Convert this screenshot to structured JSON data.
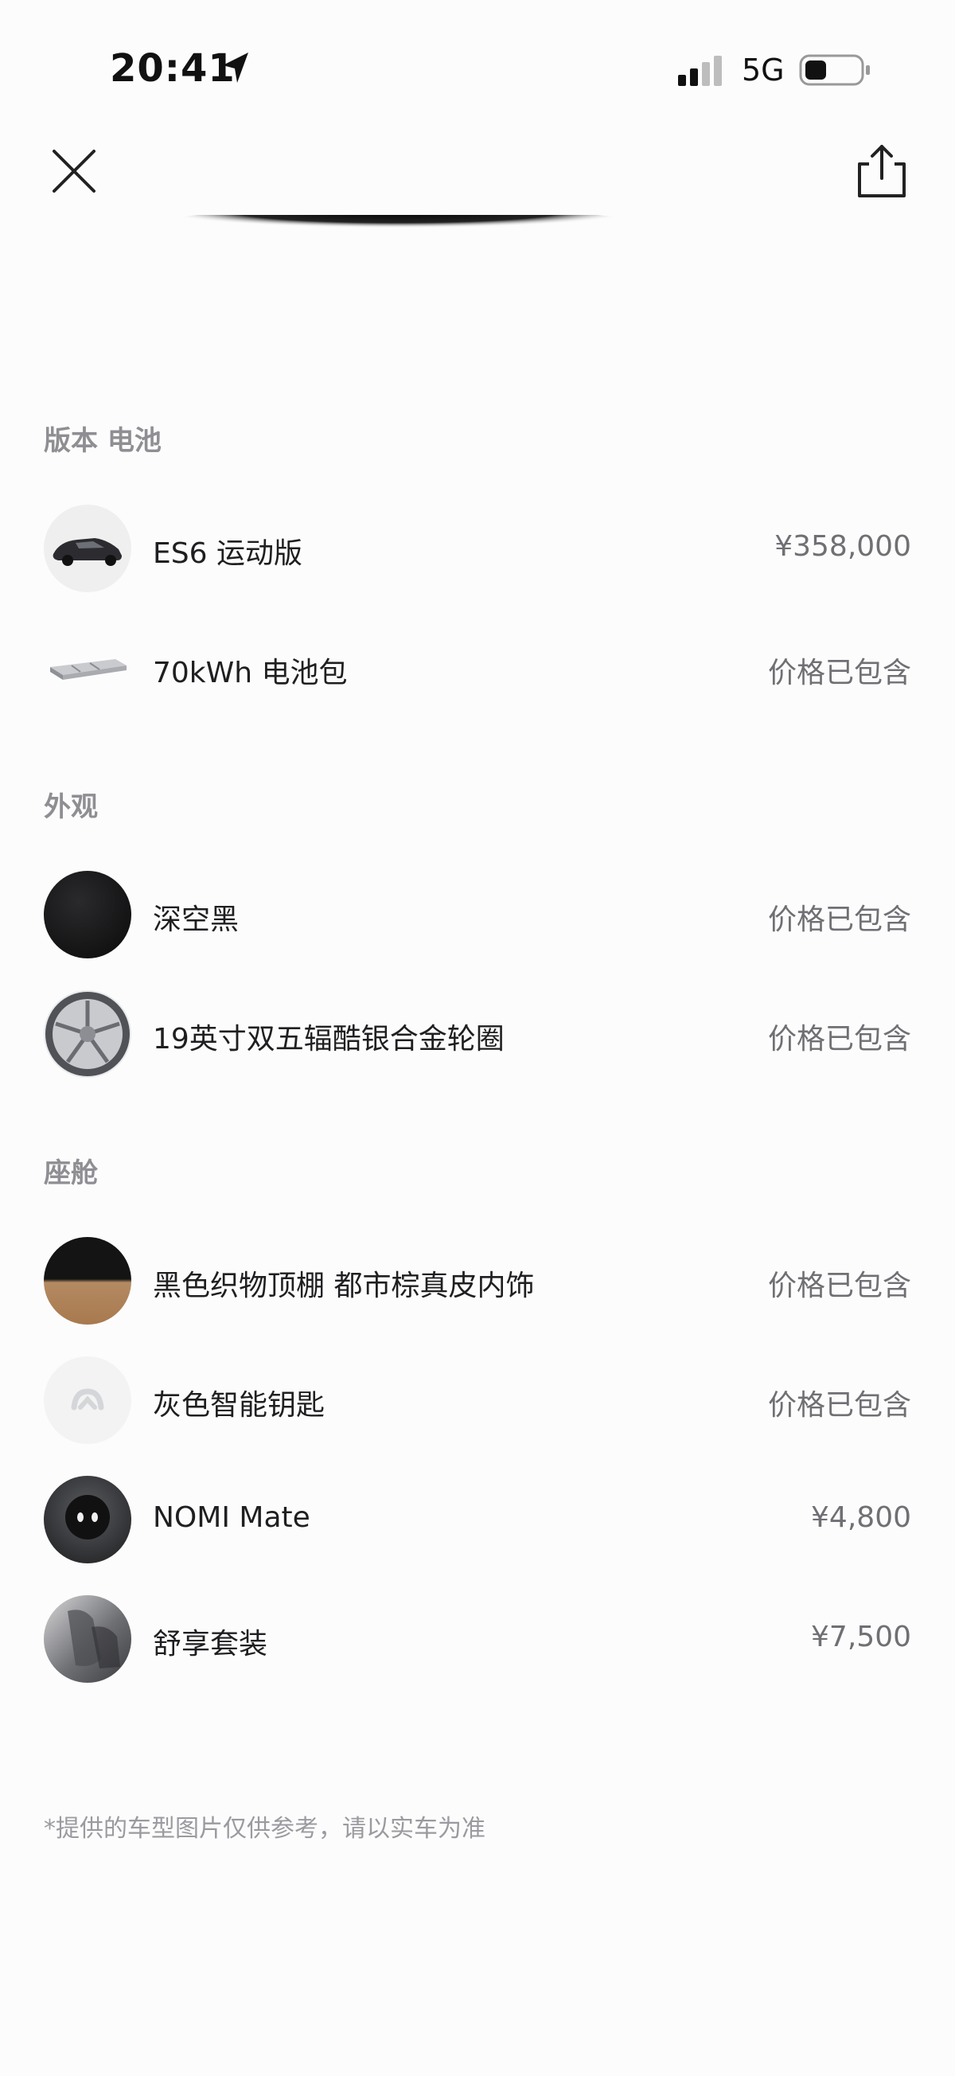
{
  "status_bar": {
    "time": "20:41",
    "network": "5G",
    "icons": [
      "location-arrow-icon",
      "signal-icon",
      "battery-icon"
    ]
  },
  "toolbar": {
    "close_icon": "close-icon",
    "share_icon": "share-icon"
  },
  "sections": [
    {
      "title": "版本 电池",
      "items": [
        {
          "name": "ES6 运动版",
          "price": "¥358,000",
          "thumb": "car-thumbnail"
        },
        {
          "name": "70kWh 电池包",
          "price": "价格已包含",
          "thumb": "battery-pack-thumbnail"
        }
      ]
    },
    {
      "title": "外观",
      "items": [
        {
          "name": "深空黑",
          "price": "价格已包含",
          "thumb": "color-swatch-black"
        },
        {
          "name": "19英寸双五辐酷银合金轮圈",
          "price": "价格已包含",
          "thumb": "wheel-thumbnail"
        }
      ]
    },
    {
      "title": "座舱",
      "items": [
        {
          "name": "黑色织物顶棚 都市棕真皮内饰",
          "price": "价格已包含",
          "thumb": "interior-swatch"
        },
        {
          "name": "灰色智能钥匙",
          "price": "价格已包含",
          "thumb": "smart-key-thumbnail"
        },
        {
          "name": "NOMI Mate",
          "price": "¥4,800",
          "thumb": "nomi-thumbnail"
        },
        {
          "name": "舒享套装",
          "price": "¥7,500",
          "thumb": "seat-thumbnail"
        }
      ]
    }
  ],
  "footnote": "*提供的车型图片仅供参考，请以实车为准"
}
